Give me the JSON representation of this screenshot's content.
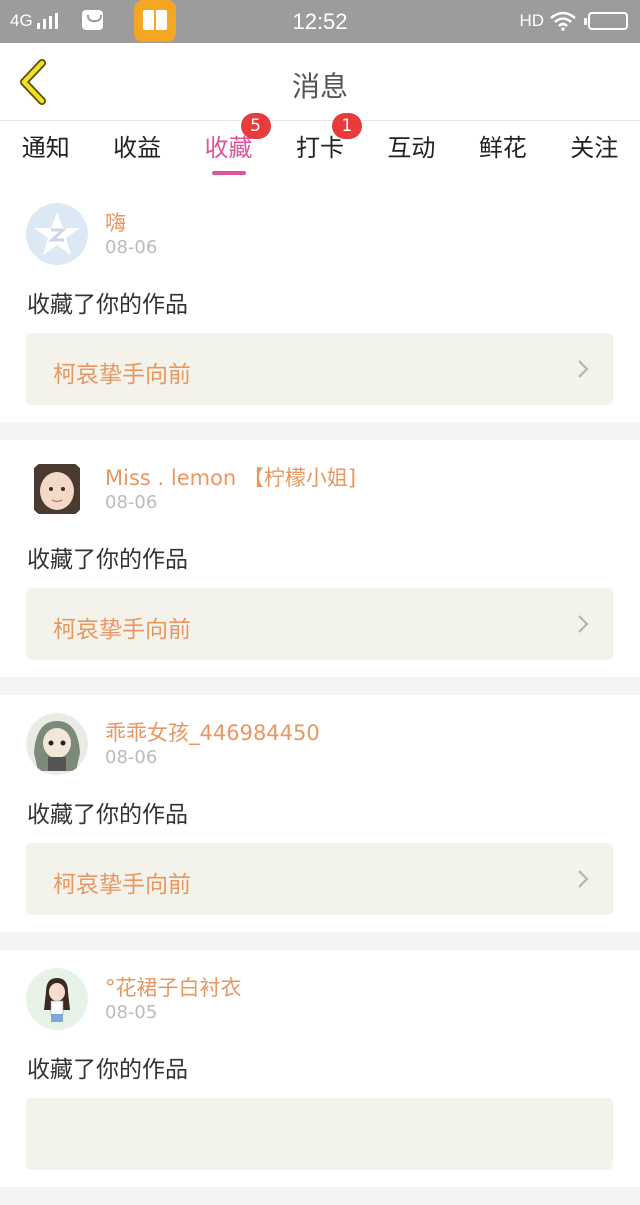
{
  "status": {
    "network": "4G",
    "time": "12:52",
    "hd": "HD"
  },
  "header": {
    "title": "消息"
  },
  "tabs": [
    {
      "label": "通知"
    },
    {
      "label": "收益"
    },
    {
      "label": "收藏",
      "badge": "5",
      "active": true
    },
    {
      "label": "打卡",
      "badge": "1"
    },
    {
      "label": "互动"
    },
    {
      "label": "鲜花"
    },
    {
      "label": "关注"
    }
  ],
  "messages": [
    {
      "user": "嗨",
      "date": "08-06",
      "action": "收藏了你的作品",
      "work": "柯哀挚手向前"
    },
    {
      "user": "Miss . lemon 【柠檬小姐]",
      "date": "08-06",
      "action": "收藏了你的作品",
      "work": "柯哀挚手向前"
    },
    {
      "user": "乖乖女孩_446984450",
      "date": "08-06",
      "action": "收藏了你的作品",
      "work": "柯哀挚手向前"
    },
    {
      "user": "°花裙子白衬衣",
      "date": "08-05",
      "action": "收藏了你的作品",
      "work": ""
    }
  ],
  "colors": {
    "accent": "#e0559a",
    "name": "#e99760",
    "badge": "#e83b3b"
  }
}
